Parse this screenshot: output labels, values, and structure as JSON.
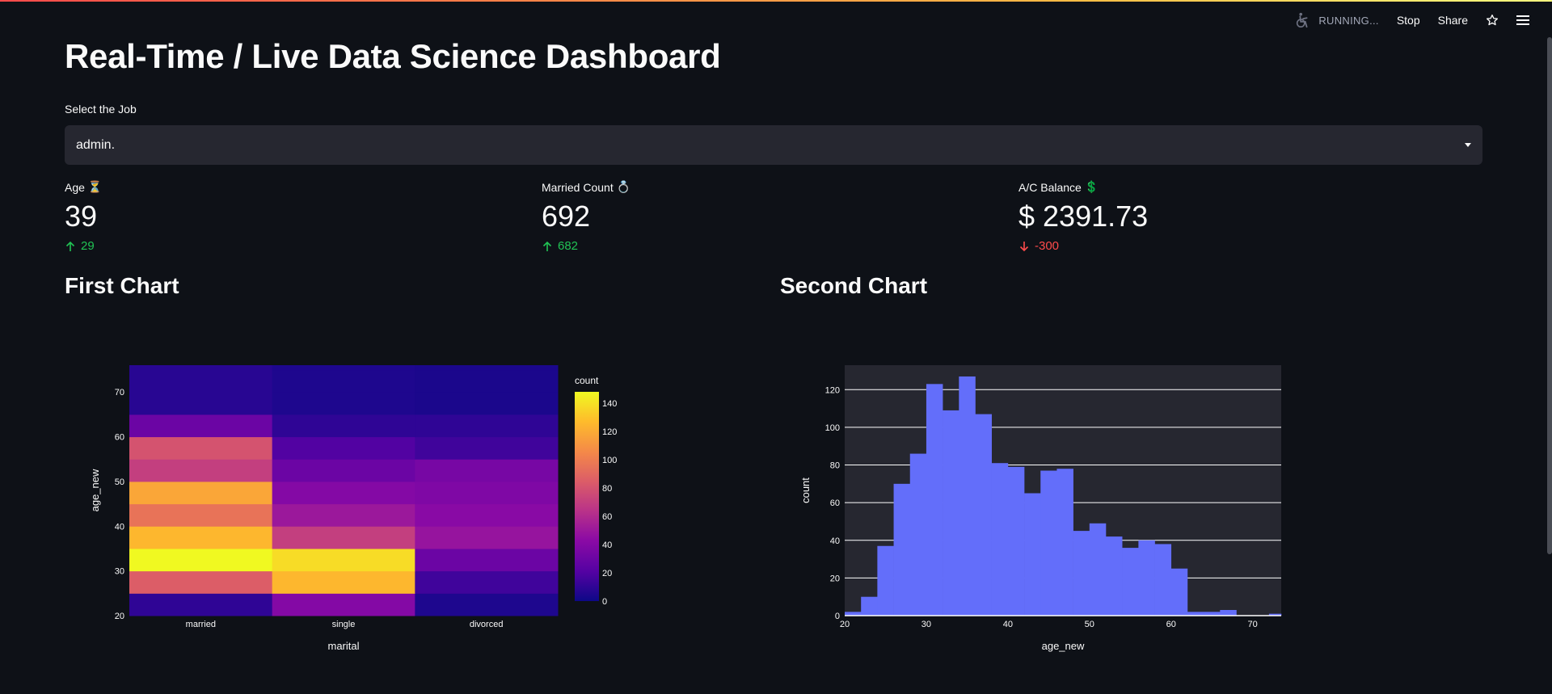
{
  "header": {
    "status": "RUNNING...",
    "stop_label": "Stop",
    "share_label": "Share"
  },
  "page_title": "Real-Time / Live Data Science Dashboard",
  "job_select": {
    "label": "Select the Job",
    "value": "admin."
  },
  "metrics": [
    {
      "label": "Age",
      "emoji": "⏳",
      "value": "39",
      "delta": "29",
      "direction": "up"
    },
    {
      "label": "Married Count",
      "emoji": "💍",
      "value": "692",
      "delta": "682",
      "direction": "up"
    },
    {
      "label": "A/C Balance",
      "emoji": "💲",
      "value": "$ 2391.73",
      "delta": "-300",
      "direction": "down"
    }
  ],
  "charts": {
    "first_title": "First Chart",
    "second_title": "Second Chart"
  },
  "colors": {
    "background": "#0e1117",
    "up": "#21c354",
    "down": "#ff4b4b",
    "histogram_bar": "#636efa",
    "plot_bg": "#262730"
  },
  "chart_data": [
    {
      "type": "heatmap",
      "xlabel": "marital",
      "ylabel": "age_new",
      "x": [
        "married",
        "single",
        "divorced"
      ],
      "y_bins": [
        [
          20,
          25
        ],
        [
          25,
          30
        ],
        [
          30,
          35
        ],
        [
          35,
          40
        ],
        [
          40,
          45
        ],
        [
          45,
          50
        ],
        [
          50,
          55
        ],
        [
          55,
          60
        ],
        [
          60,
          65
        ],
        [
          65,
          70
        ],
        [
          70,
          75
        ],
        [
          75,
          80
        ]
      ],
      "y_ticks": [
        20,
        30,
        40,
        50,
        60,
        70
      ],
      "ylim": [
        20,
        76
      ],
      "z": [
        [
          10,
          40,
          5
        ],
        [
          85,
          125,
          15
        ],
        [
          148,
          138,
          30
        ],
        [
          125,
          70,
          48
        ],
        [
          95,
          50,
          42
        ],
        [
          118,
          40,
          38
        ],
        [
          70,
          30,
          35
        ],
        [
          80,
          20,
          15
        ],
        [
          30,
          10,
          10
        ],
        [
          8,
          5,
          4
        ],
        [
          8,
          5,
          4
        ],
        [
          8,
          5,
          4
        ]
      ],
      "colorbar": {
        "title": "count",
        "ticks": [
          0,
          20,
          40,
          60,
          80,
          100,
          120,
          140
        ],
        "range": [
          0,
          148
        ]
      }
    },
    {
      "type": "bar",
      "subtype": "histogram",
      "xlabel": "age_new",
      "ylabel": "count",
      "x_ticks": [
        20,
        30,
        40,
        50,
        60,
        70
      ],
      "y_ticks": [
        0,
        20,
        40,
        60,
        80,
        100,
        120
      ],
      "xlim": [
        20,
        73.5
      ],
      "ylim": [
        0,
        133
      ],
      "bin_width": 2,
      "bins": [
        {
          "start": 20,
          "count": 2
        },
        {
          "start": 22,
          "count": 10
        },
        {
          "start": 24,
          "count": 37
        },
        {
          "start": 26,
          "count": 70
        },
        {
          "start": 28,
          "count": 86
        },
        {
          "start": 30,
          "count": 123
        },
        {
          "start": 32,
          "count": 109
        },
        {
          "start": 34,
          "count": 127
        },
        {
          "start": 36,
          "count": 107
        },
        {
          "start": 38,
          "count": 81
        },
        {
          "start": 40,
          "count": 79
        },
        {
          "start": 42,
          "count": 65
        },
        {
          "start": 44,
          "count": 77
        },
        {
          "start": 46,
          "count": 78
        },
        {
          "start": 48,
          "count": 45
        },
        {
          "start": 50,
          "count": 49
        },
        {
          "start": 52,
          "count": 42
        },
        {
          "start": 54,
          "count": 36
        },
        {
          "start": 56,
          "count": 40
        },
        {
          "start": 58,
          "count": 38
        },
        {
          "start": 60,
          "count": 25
        },
        {
          "start": 62,
          "count": 2
        },
        {
          "start": 64,
          "count": 2
        },
        {
          "start": 66,
          "count": 3
        },
        {
          "start": 68,
          "count": 0
        },
        {
          "start": 70,
          "count": 0
        },
        {
          "start": 72,
          "count": 1
        }
      ]
    }
  ]
}
